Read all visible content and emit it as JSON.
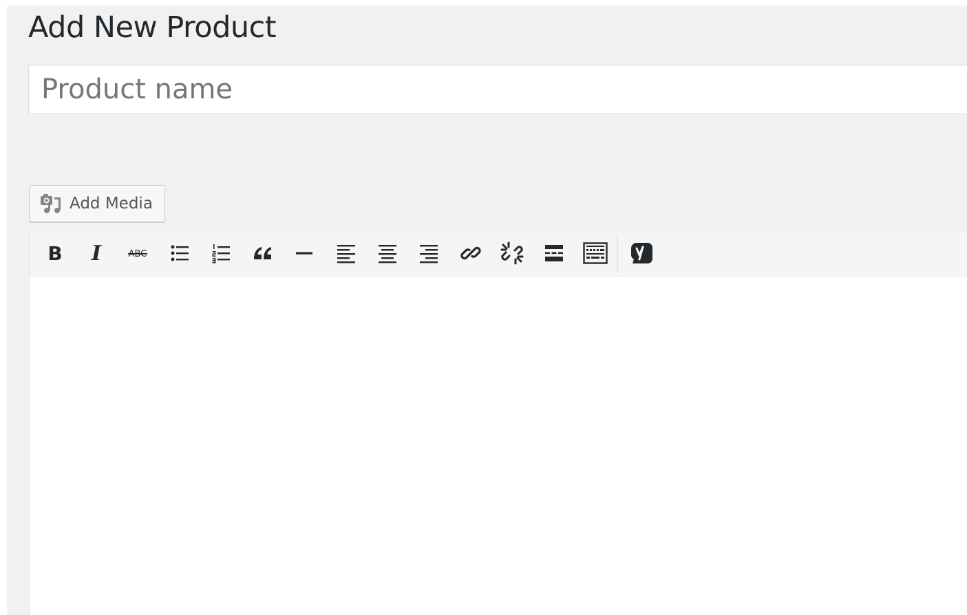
{
  "page": {
    "title": "Add New Product"
  },
  "title_field": {
    "placeholder": "Product name",
    "value": ""
  },
  "media": {
    "add_media_label": "Add Media"
  },
  "toolbar": {
    "buttons": [
      {
        "name": "bold",
        "icon": "bold-icon"
      },
      {
        "name": "italic",
        "icon": "italic-icon"
      },
      {
        "name": "strikethrough",
        "icon": "strikethrough-icon",
        "glyph": "ABC"
      },
      {
        "name": "bulleted-list",
        "icon": "bulleted-list-icon"
      },
      {
        "name": "numbered-list",
        "icon": "numbered-list-icon"
      },
      {
        "name": "blockquote",
        "icon": "blockquote-icon"
      },
      {
        "name": "horizontal-line",
        "icon": "horizontal-line-icon"
      },
      {
        "name": "align-left",
        "icon": "align-left-icon"
      },
      {
        "name": "align-center",
        "icon": "align-center-icon"
      },
      {
        "name": "align-right",
        "icon": "align-right-icon"
      },
      {
        "name": "insert-link",
        "icon": "link-icon"
      },
      {
        "name": "remove-link",
        "icon": "unlink-icon"
      },
      {
        "name": "read-more",
        "icon": "read-more-icon"
      },
      {
        "name": "toolbar-toggle",
        "icon": "kitchen-sink-icon"
      },
      {
        "name": "yoast",
        "icon": "yoast-icon"
      }
    ]
  },
  "colors": {
    "background": "#f1f1f1",
    "icon": "#555d66",
    "title": "#23282d",
    "placeholder": "#72777c",
    "border": "#dddddd"
  },
  "editor": {
    "content": ""
  }
}
